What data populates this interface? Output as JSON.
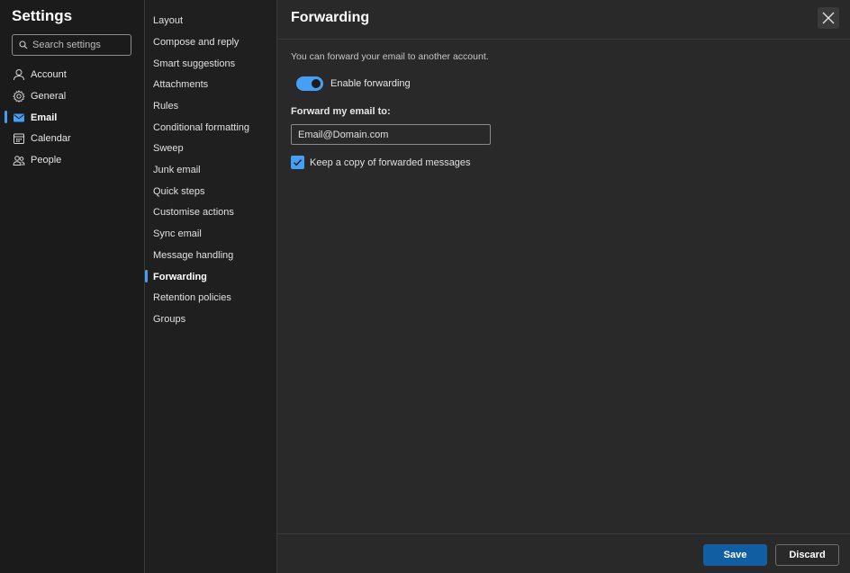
{
  "app": {
    "title": "Settings"
  },
  "search": {
    "placeholder": "Search settings"
  },
  "nav": {
    "items": [
      {
        "label": "Account",
        "icon": "person-icon"
      },
      {
        "label": "General",
        "icon": "gear-icon"
      },
      {
        "label": "Email",
        "icon": "mail-icon",
        "active": true
      },
      {
        "label": "Calendar",
        "icon": "calendar-icon"
      },
      {
        "label": "People",
        "icon": "people-icon"
      }
    ]
  },
  "email_settings": {
    "items": [
      "Layout",
      "Compose and reply",
      "Smart suggestions",
      "Attachments",
      "Rules",
      "Conditional formatting",
      "Sweep",
      "Junk email",
      "Quick steps",
      "Customise actions",
      "Sync email",
      "Message handling",
      "Forwarding",
      "Retention policies",
      "Groups"
    ],
    "active": "Forwarding"
  },
  "page": {
    "title": "Forwarding",
    "description": "You can forward your email to another account.",
    "toggle_label": "Enable forwarding",
    "toggle_on": true,
    "field_label": "Forward my email to:",
    "email_placeholder": "Email@Domain.com",
    "checkbox_label": "Keep a copy of forwarded messages",
    "checkbox_checked": true
  },
  "footer": {
    "save_label": "Save",
    "discard_label": "Discard"
  },
  "colors": {
    "accent": "#479ef5",
    "primary_button": "#115ea3",
    "background": "#292929",
    "sidebar": "#1b1b1b"
  }
}
